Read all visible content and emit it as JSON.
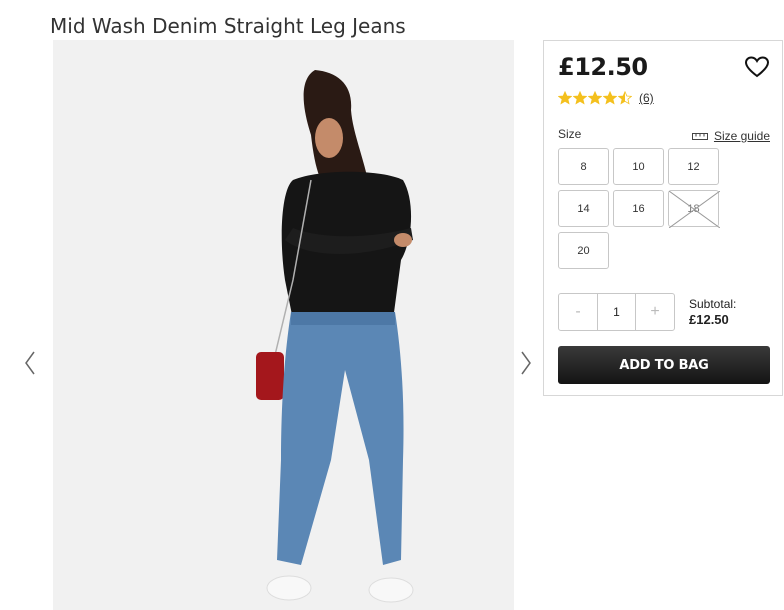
{
  "product": {
    "title": "Mid Wash Denim Straight Leg Jeans",
    "image_alt": "model wearing mid wash denim straight leg jeans"
  },
  "gallery": {
    "prev_icon": "chevron-left-icon",
    "next_icon": "chevron-right-icon"
  },
  "buy_box": {
    "price": "£12.50",
    "wishlist_icon": "heart-outline-icon",
    "rating": {
      "value": 4.5,
      "max": 5,
      "review_count": "(6)",
      "star_color": "#f4c01e"
    },
    "size_label": "Size",
    "size_guide_label": "Size guide",
    "size_guide_icon": "ruler-icon",
    "sizes": [
      {
        "label": "8",
        "available": true
      },
      {
        "label": "10",
        "available": true
      },
      {
        "label": "12",
        "available": true
      },
      {
        "label": "14",
        "available": true
      },
      {
        "label": "16",
        "available": true
      },
      {
        "label": "18",
        "available": false
      },
      {
        "label": "20",
        "available": true
      }
    ],
    "quantity": {
      "minus": "-",
      "value": "1",
      "plus": "+"
    },
    "subtotal_label": "Subtotal:",
    "subtotal_value": "£12.50",
    "add_to_bag_label": "ADD TO BAG",
    "button_color": "#222222"
  }
}
